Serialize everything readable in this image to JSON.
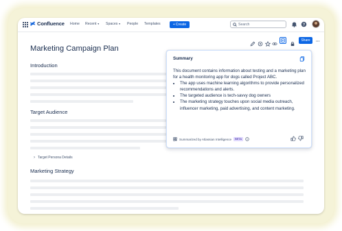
{
  "app": {
    "name": "Confluence",
    "colors": {
      "brand": "#0c66e4",
      "text": "#172b4d",
      "beta_bg": "#dfd8fd",
      "beta_text": "#5e4db2"
    }
  },
  "topnav": {
    "items": [
      {
        "label": "Home",
        "has_caret": false
      },
      {
        "label": "Recent",
        "has_caret": true
      },
      {
        "label": "Spaces",
        "has_caret": true
      },
      {
        "label": "People",
        "has_caret": false
      },
      {
        "label": "Templates",
        "has_caret": false
      }
    ],
    "create_label": "Create",
    "create_prefix": "+",
    "search_placeholder": "Search",
    "icons": [
      "app-switcher-icon",
      "notifications-icon",
      "help-icon",
      "avatar"
    ]
  },
  "toolbar": {
    "icons": [
      "edit-icon",
      "watch-icon",
      "star-icon",
      "view-icon",
      "ai-summary-icon",
      "restrictions-icon"
    ],
    "share_label": "Share",
    "more_label": "•••"
  },
  "page": {
    "title": "Marketing Campaign Plan",
    "sections": [
      {
        "heading": "Introduction"
      },
      {
        "heading": "Target Audience"
      },
      {
        "heading": "Marketing Strategy"
      }
    ],
    "expand_label": "Target Persona Details"
  },
  "summary": {
    "title": "Summary",
    "intro": "This document contains information about testing and a marketing plan for a health monitoring app for dogs called Project ABC.",
    "bullets": [
      "The app uses machine learning algorithms to provide personalized recommendations and alerts.",
      "The targeted audience is tech-savvy dog owners",
      "The marketing strategy touches upon social media outreach, influencer marketing, paid advertising, and content marketing."
    ],
    "footer_label": "Summarized by Atlassian Intelligence",
    "beta_label": "BETA"
  }
}
